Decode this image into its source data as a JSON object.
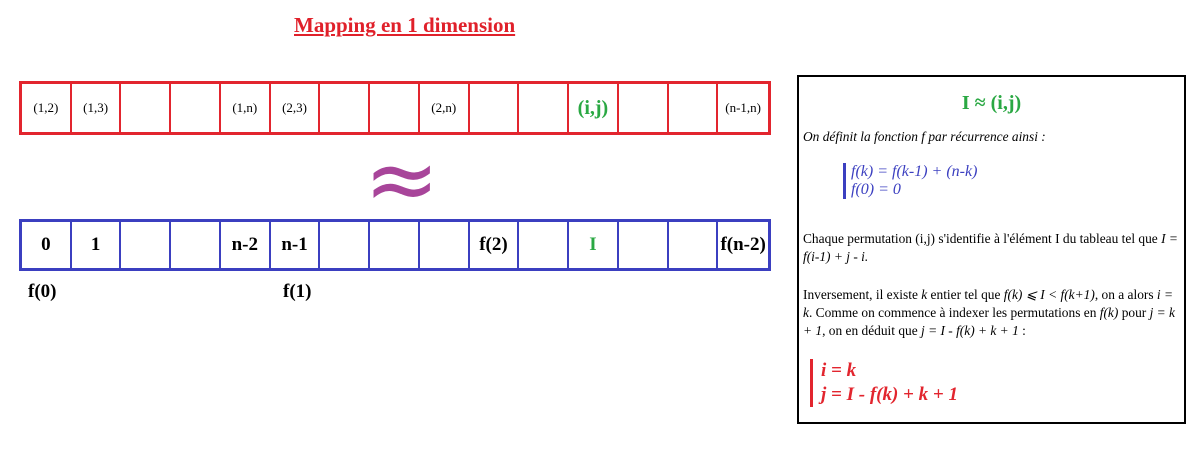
{
  "title": "Mapping en 1 dimension",
  "top_row": [
    "(1,2)",
    "(1,3)",
    "",
    "",
    "(1,n)",
    "(2,3)",
    "",
    "",
    "(2,n)",
    "",
    "",
    "(i,j)",
    "",
    "",
    "(n-1,n)"
  ],
  "approx_symbol": "≈",
  "bottom_row": [
    "0",
    "1",
    "",
    "",
    "n-2",
    "n-1",
    "",
    "",
    "",
    "f(2)",
    "",
    "I",
    "",
    "",
    "f(n-2)"
  ],
  "labels": {
    "f0": "f(0)",
    "f1": "f(1)"
  },
  "panel": {
    "title": "I ≈ (i,j)",
    "intro": "On définit la fonction f par récurrence ainsi :",
    "recurrence": [
      "f(k) = f(k-1) + (n-k)",
      "f(0) = 0"
    ],
    "para1_a": "Chaque permutation (i,j) s'identifie à l'élément I du tableau tel que ",
    "para1_formula": "I = f(i-1) + j - i.",
    "para2_a": "Inversement, il existe ",
    "para2_k": "k",
    "para2_b": " entier tel que ",
    "para2_ineq": "f(k) ⩽ I < f(k+1)",
    "para2_c": ", on a alors ",
    "para2_ik": "i = k",
    "para2_d": ". Comme on commence à indexer les permutations en ",
    "para2_fk": "f(k)",
    "para2_e": " pour ",
    "para2_j": "j = k + 1",
    "para2_f": ", on en déduit que ",
    "para2_jform": "j = I - f(k) + k + 1",
    "para2_g": " :",
    "result": [
      "i = k",
      "j = I - f(k) + k + 1"
    ]
  }
}
